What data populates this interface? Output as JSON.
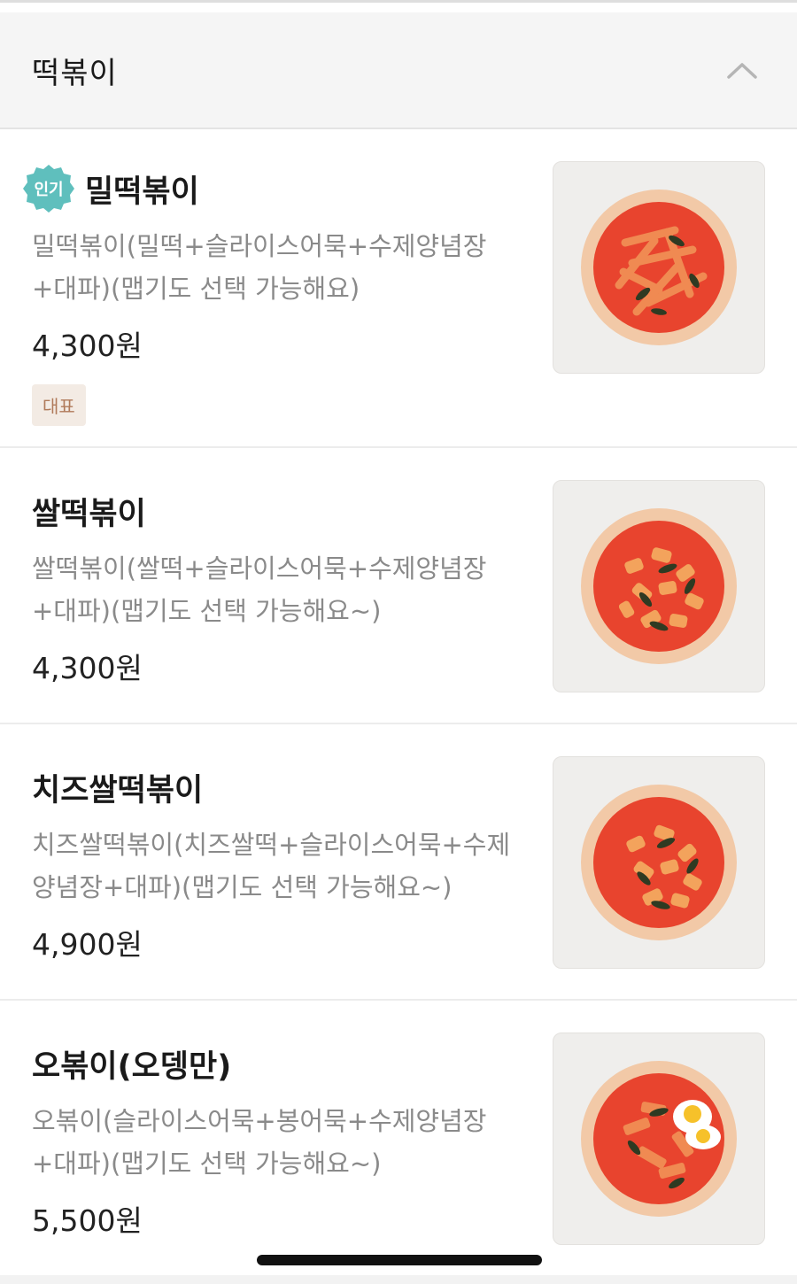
{
  "section": {
    "title": "떡볶이"
  },
  "items": [
    {
      "badge": "인기",
      "name": "밀떡볶이",
      "desc_line1": "밀떡볶이(밀떡+슬라이스어묵+수제양념장",
      "desc_line2": "+대파)(맵기도 선택 가능해요)",
      "price": "4,300원",
      "tag": "대표"
    },
    {
      "name": "쌀떡볶이",
      "desc_line1": "쌀떡볶이(쌀떡+슬라이스어묵+수제양념장",
      "desc_line2": "+대파)(맵기도 선택 가능해요~)",
      "price": "4,300원"
    },
    {
      "name": "치즈쌀떡볶이",
      "desc_line1": "치즈쌀떡볶이(치즈쌀떡+슬라이스어묵+수제",
      "desc_line2": "양념장+대파)(맵기도 선택 가능해요~)",
      "price": "4,900원"
    },
    {
      "name": "오볶이(오뎅만)",
      "desc_line1": "오볶이(슬라이스어묵+봉어묵+수제양념장",
      "desc_line2": "+대파)(맵기도 선택 가능해요~)",
      "price": "5,500원"
    }
  ],
  "colors": {
    "badge_teal": "#5fbfbd",
    "tag_bg": "#f3ebe4",
    "tag_text": "#b07a5a",
    "desc_gray": "#8a8a8a"
  },
  "icons": {
    "header_toggle": "chevron-up-icon",
    "popular": "popular-badge-icon"
  }
}
